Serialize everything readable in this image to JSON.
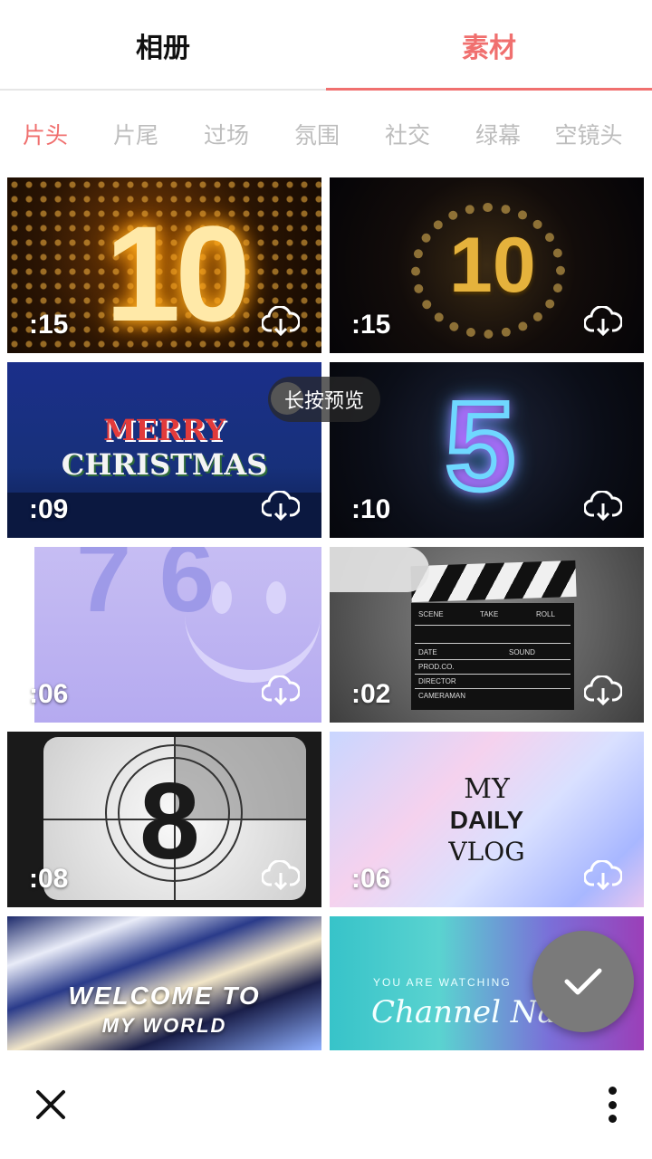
{
  "tabs": [
    {
      "label": "相册",
      "active": false
    },
    {
      "label": "素材",
      "active": true
    }
  ],
  "accent_color": "#f0706f",
  "categories": [
    "片头",
    "片尾",
    "过场",
    "氛围",
    "社交",
    "绿幕",
    "空镜头"
  ],
  "tooltip": "长按预览",
  "tiles": [
    {
      "duration": ":15",
      "art": "10"
    },
    {
      "duration": ":15",
      "art": "10"
    },
    {
      "duration": ":09",
      "art_line1": "MERRY",
      "art_line2": "CHRISTMAS"
    },
    {
      "duration": ":10",
      "art": "5"
    },
    {
      "duration": ":06",
      "art": "7 6"
    },
    {
      "duration": ":02",
      "clapper_labels": [
        "SCENE",
        "TAKE",
        "ROLL",
        "DATE",
        "SOUND",
        "PROD.CO.",
        "DIRECTOR",
        "CAMERAMAN"
      ]
    },
    {
      "duration": ":08",
      "art": "8"
    },
    {
      "duration": ":06",
      "art_line1": "MY",
      "art_line2": "DAILY",
      "art_line3": "VLOG"
    },
    {
      "art_line1": "WELCOME TO",
      "art_line2": "MY WORLD"
    },
    {
      "art_line1": "YOU ARE WATCHING",
      "art_line2": "Channel Nam"
    }
  ],
  "icons": {
    "download": "cloud-download-icon",
    "confirm": "check-icon",
    "close": "close-icon",
    "more": "more-vertical-icon"
  }
}
